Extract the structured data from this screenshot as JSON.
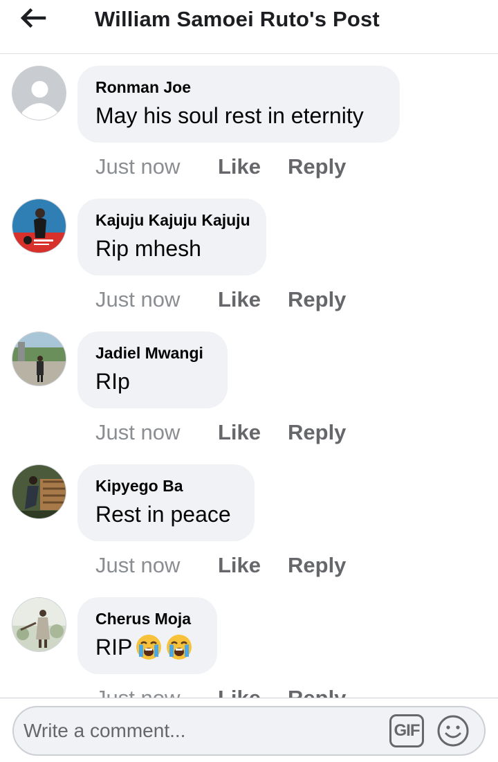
{
  "header": {
    "back_icon": "arrow-left-icon",
    "title": "William Samoei Ruto's Post"
  },
  "comments": [
    {
      "author": "Ronman Joe",
      "text": "May his soul rest in eternity",
      "time": "Just now",
      "like": "Like",
      "reply": "Reply",
      "avatar": "default-avatar"
    },
    {
      "author": "Kajuju Kajuju Kajuju",
      "text": "Rip mhesh",
      "time": "Just now",
      "like": "Like",
      "reply": "Reply",
      "avatar": "photo-avatar"
    },
    {
      "author": "Jadiel Mwangi",
      "text": "RIp",
      "time": "Just now",
      "like": "Like",
      "reply": "Reply",
      "avatar": "photo-avatar"
    },
    {
      "author": "Kipyego Ba",
      "text": "Rest in peace",
      "time": "Just now",
      "like": "Like",
      "reply": "Reply",
      "avatar": "photo-avatar"
    },
    {
      "author": "Cherus Moja",
      "text": "RIP",
      "emojis": [
        "loudly-crying-face",
        "loudly-crying-face"
      ],
      "time": "Just now",
      "like": "Like",
      "reply": "Reply",
      "avatar": "photo-avatar"
    }
  ],
  "composer": {
    "placeholder": "Write a comment...",
    "gif_label": "GIF",
    "emoji_icon": "smiley-icon"
  },
  "colors": {
    "bubble": "#f0f2f5",
    "secondary_text": "#65676b",
    "time_text": "#8a8d91"
  }
}
